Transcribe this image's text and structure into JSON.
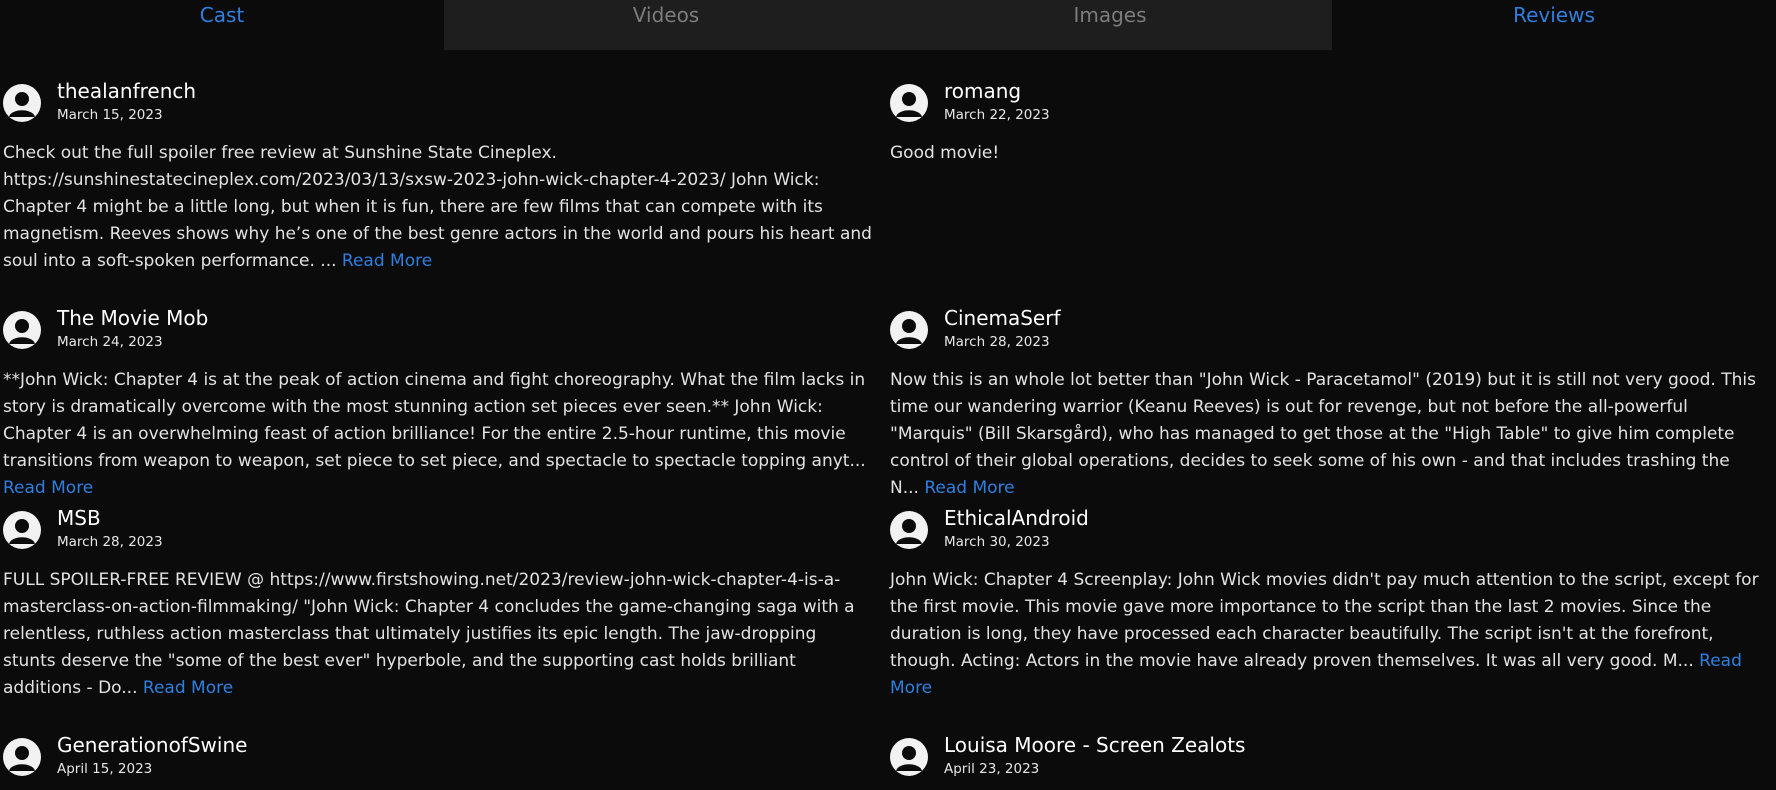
{
  "tabs": [
    {
      "label": "Cast"
    },
    {
      "label": "Videos"
    },
    {
      "label": "Images"
    },
    {
      "label": "Reviews"
    }
  ],
  "reviews": [
    {
      "author": "thealanfrench",
      "date": "March 15, 2023",
      "text": "Check out the full spoiler free review at Sunshine State Cineplex. https://sunshinestatecineplex.com/2023/03/13/sxsw-2023-john-wick-chapter-4-2023/ John Wick: Chapter 4 might be a little long, but when it is fun, there are few films that can compete with its magnetism. Reeves shows why he’s one of the best genre actors in the world and pours his heart and soul into a soft-spoken performance. ...",
      "more": "Read More"
    },
    {
      "author": "romang",
      "date": "March 22, 2023",
      "text": "Good movie!",
      "more": ""
    },
    {
      "author": "The Movie Mob",
      "date": "March 24, 2023",
      "text": "**John Wick: Chapter 4 is at the peak of action cinema and fight choreography. What the film lacks in story is dramatically overcome with the most stunning action set pieces ever seen.** John Wick: Chapter 4 is an overwhelming feast of action brilliance! For the entire 2.5-hour runtime, this movie transitions from weapon to weapon, set piece to set piece, and spectacle to spectacle topping anyt...",
      "more": "Read More"
    },
    {
      "author": "CinemaSerf",
      "date": "March 28, 2023",
      "text": "Now this is an whole lot better than \"John Wick - Paracetamol\" (2019) but it is still not very good. This time our wandering warrior (Keanu Reeves) is out for revenge, but not before the all-powerful \"Marquis\" (Bill Skarsgård), who has managed to get those at the \"High Table\" to give him complete control of their global operations, decides to seek some of his own - and that includes trashing the N...",
      "more": "Read More"
    },
    {
      "author": "MSB",
      "date": "March 28, 2023",
      "text": "FULL SPOILER-FREE REVIEW @ https://www.firstshowing.net/2023/review-john-wick-chapter-4-is-a-masterclass-on-action-filmmaking/ \"John Wick: Chapter 4 concludes the game-changing saga with a relentless, ruthless action masterclass that ultimately justifies its epic length. The jaw-dropping stunts deserve the \"some of the best ever\" hyperbole, and the supporting cast holds brilliant additions - Do...",
      "more": "Read More"
    },
    {
      "author": "EthicalAndroid",
      "date": "March 30, 2023",
      "text": "John Wick: Chapter 4 Screenplay: John Wick movies didn't pay much attention to the script, except for the first movie. This movie gave more importance to the script than the last 2 movies. Since the duration is long, they have processed each character beautifully. The script isn't at the forefront, though. Acting: Actors in the movie have already proven themselves. It was all very good. M...",
      "more": "Read More"
    },
    {
      "author": "GenerationofSwine",
      "date": "April 15, 2023",
      "text": "",
      "more": ""
    },
    {
      "author": "Louisa Moore - Screen Zealots",
      "date": "April 23, 2023",
      "text": "",
      "more": ""
    }
  ]
}
